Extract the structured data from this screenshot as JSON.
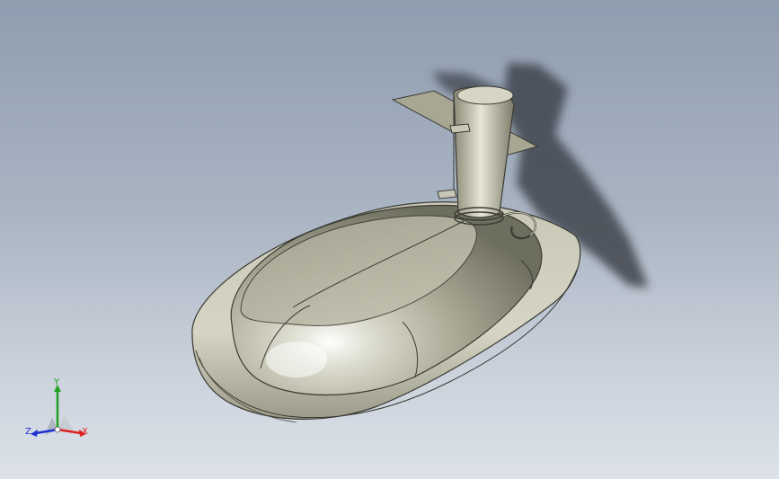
{
  "view": {
    "model": "hovercraft-hull",
    "background_top": "#8f9db0",
    "background_bottom": "#dde2e9",
    "model_color": "#b9b8a5",
    "edge_color": "#3a3a34",
    "shadow_color": "#3f454d"
  },
  "triad": {
    "x_label": "X",
    "y_label": "Y",
    "z_label": "Z",
    "x_color": "#e02020",
    "y_color": "#1fa01f",
    "z_color": "#2030d0"
  }
}
